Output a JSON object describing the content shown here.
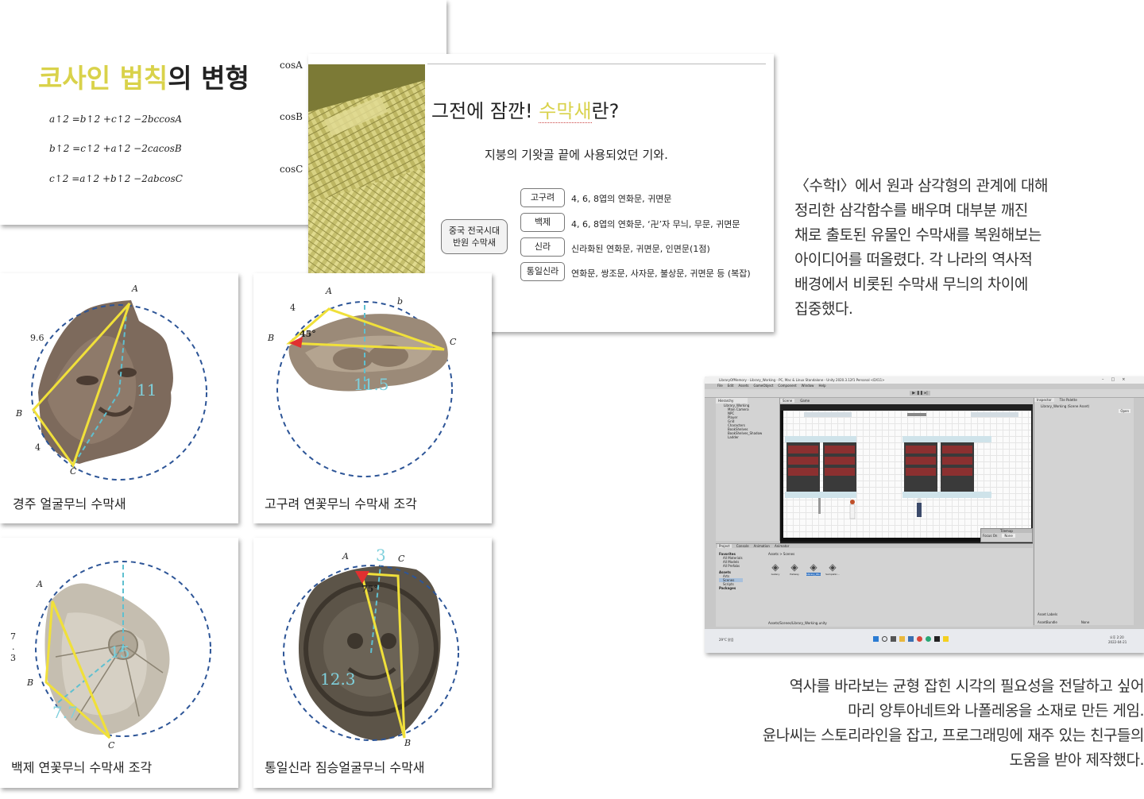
{
  "slide1": {
    "title_highlight": "코사인 법칙",
    "title_rest": "의 변형",
    "formulas": [
      "a↑2 =b↑2 +c↑2 −2bccosA",
      "b↑2 =c↑2 +a↑2 −2cacosB",
      "c↑2 =a↑2 +b↑2 −2abcosC"
    ],
    "cos_labels": [
      "cosA",
      "cosB",
      "cosC"
    ]
  },
  "slide2": {
    "title_pre": "그전에 잠깐! ",
    "title_highlight": "수막새",
    "title_post": "란?",
    "subtitle": "지붕의 기왓골 끝에 사용되었던 기와.",
    "left_box": [
      "중국 전국시대",
      "반원 수막새"
    ],
    "rows": [
      {
        "tag": "고구려",
        "text": "4, 6, 8엽의 연화문, 귀면문"
      },
      {
        "tag": "백제",
        "text": "4, 6, 8엽의 연화문, ‘卍’자 무늬, 무문, 귀면문"
      },
      {
        "tag": "신라",
        "text": "신라화된 연화문, 귀면문, 인면문(1점)"
      },
      {
        "tag": "통일신라",
        "text": "연화문, 쌍조문, 사자문, 불상문, 귀면문 등 (복잡)"
      }
    ],
    "colors": {
      "highlight": "#d9d24a"
    }
  },
  "photos": [
    {
      "caption": "경주 얼굴무늬 수막새",
      "labels": {
        "a": "A",
        "b": "B",
        "c": "C"
      },
      "numbers": [
        "9.6",
        "4",
        "11"
      ]
    },
    {
      "caption": "고구려 연꽃무늬 수막새 조각",
      "labels": {
        "a": "A",
        "b": "B",
        "c": "C"
      },
      "numbers": [
        "4",
        "b",
        "45°",
        "11.5"
      ]
    },
    {
      "caption": "백제 연꽃무늬 수막새 조각",
      "labels": {
        "a": "A",
        "b": "B",
        "c": "C"
      },
      "numbers": [
        "7",
        ".",
        "3",
        "15",
        "7.7"
      ]
    },
    {
      "caption": "통일신라 짐승얼굴무늬 수막새",
      "labels": {
        "a": "A",
        "b": "B",
        "c": "C"
      },
      "numbers": [
        "3",
        "75°",
        "12.3"
      ]
    }
  ],
  "paragraph1": [
    "〈수학Ⅰ〉에서 원과 삼각형의 관계에 대해",
    "정리한 삼각함수를 배우며 대부분 깨진",
    "채로 출토된 유물인 수막새를 복원해보는",
    "아이디어를 떠올렸다. 각 나라의 역사적",
    "배경에서 비롯된 수막새 무늬의 차이에",
    "집중했다."
  ],
  "paragraph2": [
    "역사를 바라보는 균형 잡힌 시각의 필요성을 전달하고 싶어",
    "마리 앙투아네트와 나폴레옹을 소재로 만든 게임.",
    "윤나씨는 스토리라인을 잡고, 프로그래밍에 재주 있는 친구들의",
    "도움을 받아 제작했다."
  ],
  "unity": {
    "window_title": "LibraryOfMemory - Library_Working - PC, Mac & Linux Standalone - Unity 2020.3.12f1 Personal <DX11>",
    "menu": [
      "File",
      "Edit",
      "Assets",
      "GameObject",
      "Component",
      "Window",
      "Help"
    ],
    "hierarchy_tab": "Hierarchy",
    "scene_tab": "Scene",
    "game_tab": "Game",
    "inspector_tab": "Inspector",
    "tile_palette_tab": "Tile Palette",
    "hierarchy_items": [
      "Library_Working",
      "Main Camera",
      "NPC",
      "Player",
      "Grid",
      "Characters",
      "BookShelves",
      "BookShelves_Shadow",
      "Ladder"
    ],
    "inspector_title": "Library_Working (Scene Asset)",
    "inspector_open": "Open",
    "project_tabs": [
      "Project",
      "Console",
      "Animation",
      "Animator"
    ],
    "favorites": [
      "Favorites",
      "All Materials",
      "All Models",
      "All Prefabs"
    ],
    "assets_tree": [
      "Assets",
      "Arts",
      "Scenes",
      "Scripts",
      "Packages"
    ],
    "breadcrumb": "Assets > Scenes",
    "scene_files": [
      "Gallery",
      "Hallway",
      "Library_Wo...",
      "SampleSc..."
    ],
    "path": "Assets/Scenes/Library_Working.unity",
    "asset_labels": "Asset Labels",
    "assetbundle": "AssetBundle",
    "none": "None",
    "tilemap": "Tilemap",
    "focus_on": "Focus On",
    "time": "오후 2:20",
    "date": "2022-04-21",
    "weather": "29°C 맑음",
    "colors": {
      "accent": "#3a78c4"
    }
  }
}
